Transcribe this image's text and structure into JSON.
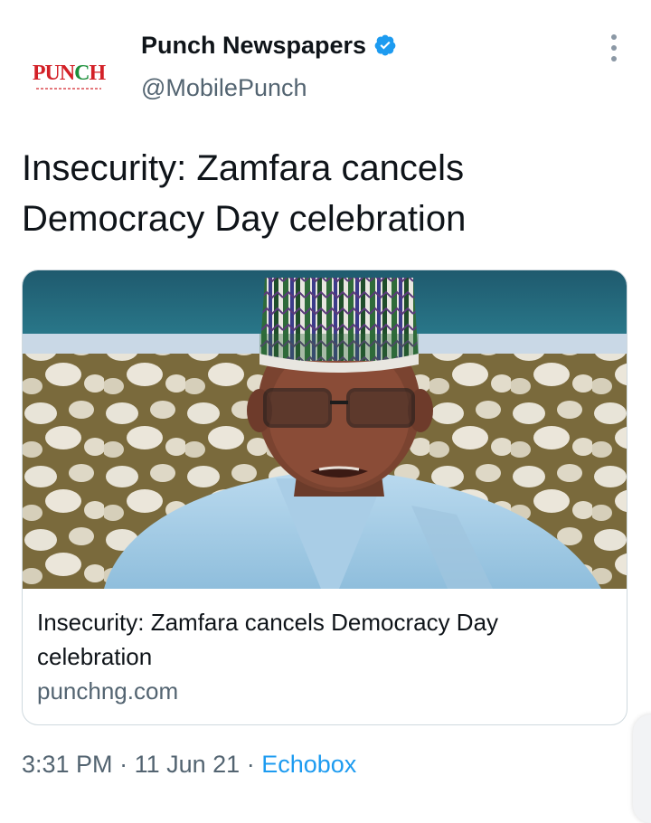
{
  "tweet": {
    "author": {
      "display_name": "Punch Newspapers",
      "handle": "@MobilePunch",
      "verified": true,
      "avatar_text": "PUNCH",
      "avatar_text_prefix": "PUN",
      "avatar_text_flag": "C",
      "avatar_text_suffix": "H"
    },
    "text": "Insecurity: Zamfara cancels Democracy Day celebration",
    "card": {
      "image_alt": "photo",
      "title": "Insecurity: Zamfara cancels Democracy Day celebration",
      "domain": "punchng.com"
    },
    "meta": {
      "time": "3:31 PM",
      "separator": "·",
      "date": "11 Jun 21",
      "source": "Echobox"
    }
  },
  "icons": {
    "verified": "verified-badge-icon",
    "more": "more-vertical-icon"
  },
  "colors": {
    "text": "#0f1419",
    "secondary": "#536471",
    "accent": "#1d9bf0",
    "border": "#cfd9de",
    "brand_red": "#d32027"
  }
}
